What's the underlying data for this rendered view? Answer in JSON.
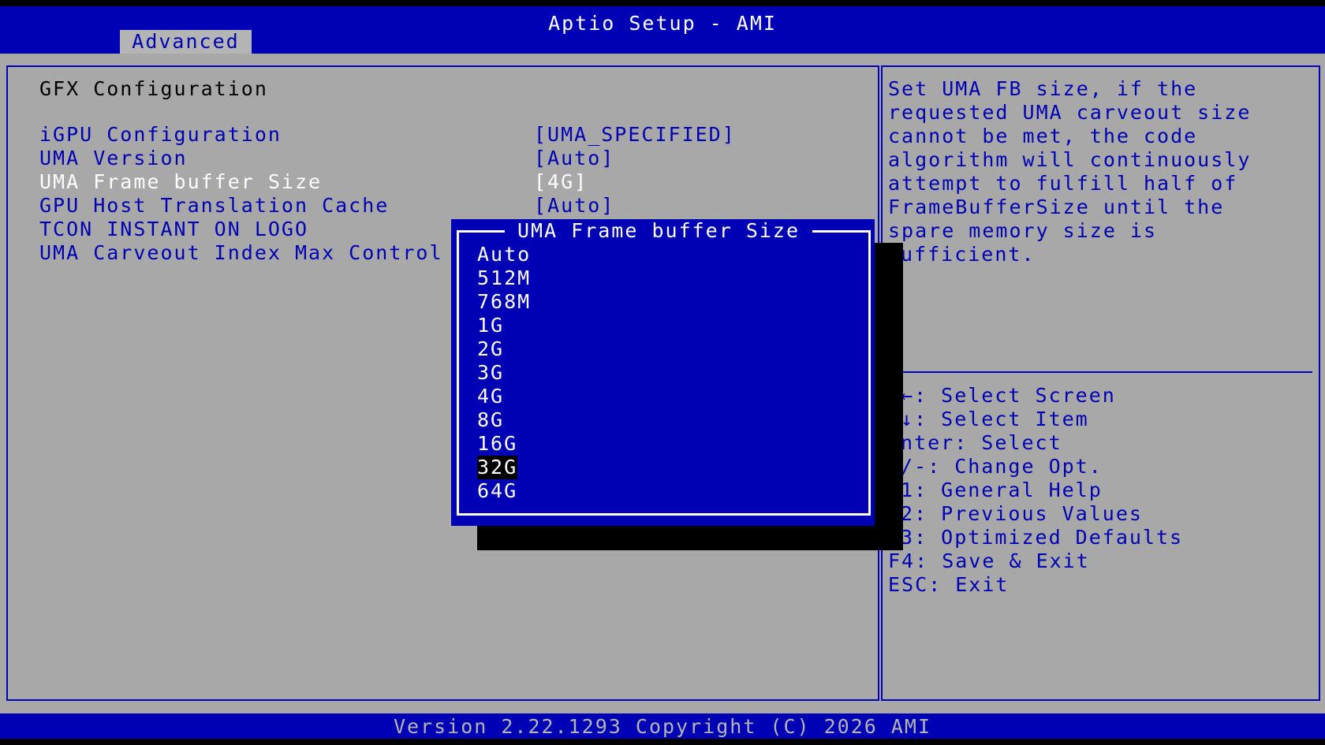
{
  "header": {
    "title": "Aptio Setup - AMI",
    "tabs": [
      "Advanced"
    ]
  },
  "main": {
    "section_title": "GFX Configuration",
    "settings": [
      {
        "label": "iGPU Configuration",
        "value": "[UMA_SPECIFIED]"
      },
      {
        "label": "UMA Version",
        "value": "[Auto]"
      },
      {
        "label": "UMA Frame buffer Size",
        "value": "[4G]",
        "selected": true
      },
      {
        "label": "GPU Host Translation Cache",
        "value": "[Auto]"
      },
      {
        "label": "TCON INSTANT ON LOGO",
        "value": ""
      },
      {
        "label": "UMA Carveout Index Max Control",
        "value": ""
      }
    ]
  },
  "help": {
    "description_lines": [
      "Set UMA FB size, if the",
      "requested UMA carveout size",
      "cannot be met, the code",
      "algorithm will continuously",
      "attempt to fulfill half of",
      "FrameBufferSize until the",
      "spare memory size is",
      "ufficient."
    ],
    "key_lines": [
      "←: Select Screen",
      "↓: Select Item",
      "nter: Select",
      "/-: Change Opt.",
      "1: General Help",
      "2: Previous Values",
      "3: Optimized Defaults",
      "F4: Save & Exit",
      "ESC: Exit"
    ]
  },
  "popup": {
    "title": "UMA Frame buffer Size",
    "options": [
      "Auto",
      "512M",
      "768M",
      "1G",
      "2G",
      "3G",
      "4G",
      "8G",
      "16G",
      "32G",
      "64G"
    ],
    "highlighted": "32G"
  },
  "footer": {
    "version": "Version 2.22.1293 Copyright (C) 2026 AMI"
  },
  "colors": {
    "bios_blue": "#0000b4",
    "panel_gray": "#a8a8a8",
    "highlight_white": "#ffffff",
    "shadow_black": "#000000"
  }
}
